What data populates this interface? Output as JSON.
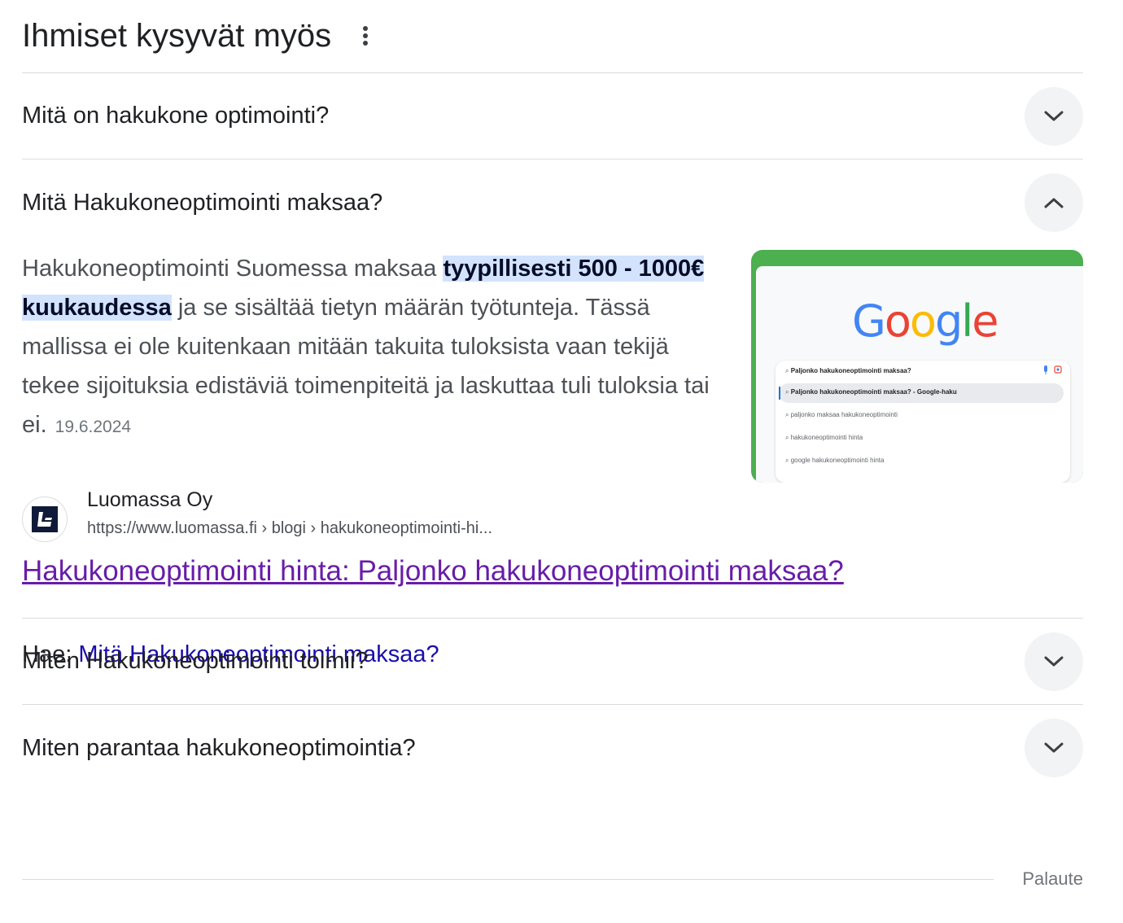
{
  "paa": {
    "title": "Ihmiset kysyvät myös",
    "more_icon": "more-vert-icon"
  },
  "questions": [
    {
      "text": "Mitä on hakukone optimointi?",
      "expanded": false
    },
    {
      "text": "Mitä Hakukoneoptimointi maksaa?",
      "expanded": true
    },
    {
      "text": "Miten Hakukoneoptimointi toimii?",
      "expanded": false
    },
    {
      "text": "Miten parantaa hakukoneoptimointia?",
      "expanded": false
    }
  ],
  "answer": {
    "text_before": "Hakukoneoptimointi Suomessa maksaa ",
    "highlight": "tyypillisesti 500 - 1000€ kuukaudessa",
    "text_after": " ja se sisältää tietyn määrän työtunteja. Tässä mallissa ei ole kuitenkaan mitään takuita tuloksista vaan tekijä tekee sijoituksia edistäviä toimenpiteitä ja laskuttaa tuli tuloksia tai ei.",
    "date": "19.6.2024",
    "thumbnail": {
      "logo": "Google",
      "search_query": "Paljonko hakukoneoptimointi maksaa?",
      "suggestions": [
        "Paljonko hakukoneoptimointi maksaa? - Google-haku",
        "paljonko maksaa hakukoneoptimointi",
        "hakukoneoptimointi hinta",
        "google hakukoneoptimointi hinta"
      ]
    }
  },
  "source": {
    "name": "Luomassa Oy",
    "url": "https://www.luomassa.fi › blogi › hakukoneoptimointi-hi...",
    "title": "Hakukoneoptimointi hinta: Paljonko hakukoneoptimointi maksaa?"
  },
  "search": {
    "prefix": "Hae: ",
    "query": "Mitä Hakukoneoptimointi maksaa?"
  },
  "footer": {
    "feedback": "Palaute"
  },
  "colors": {
    "link_visited": "#681da8",
    "link": "#1a0dab",
    "highlight_bg": "#d3e3fd",
    "thumb_green": "#4caf50"
  }
}
